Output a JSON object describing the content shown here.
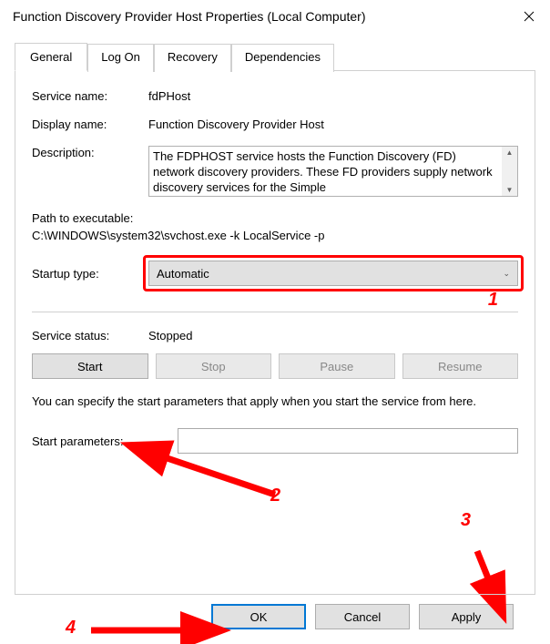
{
  "window": {
    "title": "Function Discovery Provider Host Properties (Local Computer)"
  },
  "tabs": {
    "general": "General",
    "logon": "Log On",
    "recovery": "Recovery",
    "dependencies": "Dependencies"
  },
  "labels": {
    "service_name": "Service name:",
    "display_name": "Display name:",
    "description": "Description:",
    "path_label": "Path to executable:",
    "startup_type": "Startup type:",
    "service_status": "Service status:",
    "start_parameters": "Start parameters:"
  },
  "values": {
    "service_name": "fdPHost",
    "display_name": "Function Discovery Provider Host",
    "description": "The FDPHOST service hosts the Function Discovery (FD) network discovery providers. These FD providers supply network discovery services for the Simple",
    "path": "C:\\WINDOWS\\system32\\svchost.exe -k LocalService -p",
    "startup_type": "Automatic",
    "service_status": "Stopped",
    "start_parameters": ""
  },
  "buttons": {
    "start": "Start",
    "stop": "Stop",
    "pause": "Pause",
    "resume": "Resume",
    "ok": "OK",
    "cancel": "Cancel",
    "apply": "Apply"
  },
  "hint": "You can specify the start parameters that apply when you start the service from here.",
  "annotations": {
    "n1": "1",
    "n2": "2",
    "n3": "3",
    "n4": "4"
  }
}
